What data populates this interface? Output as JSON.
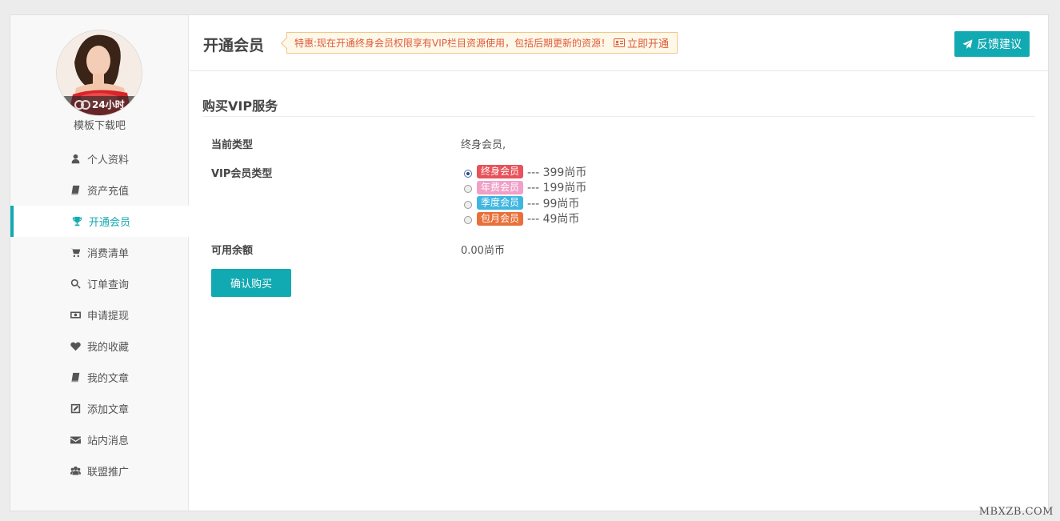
{
  "user": {
    "avatar_caption": "24小时",
    "username": "模板下载吧"
  },
  "sidebar": {
    "items": [
      {
        "label": "个人资料",
        "icon": "user-icon"
      },
      {
        "label": "资产充值",
        "icon": "book-icon"
      },
      {
        "label": "开通会员",
        "icon": "trophy-icon",
        "active": true
      },
      {
        "label": "消费清单",
        "icon": "cart-icon"
      },
      {
        "label": "订单查询",
        "icon": "search-icon"
      },
      {
        "label": "申请提现",
        "icon": "money-icon"
      },
      {
        "label": "我的收藏",
        "icon": "heart-icon"
      },
      {
        "label": "我的文章",
        "icon": "book-icon"
      },
      {
        "label": "添加文章",
        "icon": "edit-icon"
      },
      {
        "label": "站内消息",
        "icon": "envelope-icon"
      },
      {
        "label": "联盟推广",
        "icon": "users-icon"
      }
    ]
  },
  "header": {
    "title": "开通会员",
    "notice_text": "特惠:现在开通终身会员权限享有VIP栏目资源使用，包括后期更新的资源！",
    "notice_link": "立即开通",
    "feedback_label": "反馈建议"
  },
  "content": {
    "section_title": "购买VIP服务",
    "current_type_label": "当前类型",
    "current_type_value": "终身会员,",
    "vip_type_label": "VIP会员类型",
    "vip_options": [
      {
        "tag": "终身会员",
        "price": "--- 399尚币",
        "color": "#e8525a",
        "checked": true
      },
      {
        "tag": "年费会员",
        "price": "--- 199尚币",
        "color": "#f0a0c8",
        "checked": false
      },
      {
        "tag": "季度会员",
        "price": "--- 99尚币",
        "color": "#3fb6e0",
        "checked": false
      },
      {
        "tag": "包月会员",
        "price": "--- 49尚币",
        "color": "#e8703a",
        "checked": false
      }
    ],
    "balance_label": "可用余额",
    "balance_value": "0.00尚币",
    "buy_label": "确认购买"
  },
  "watermark": "MBXZB.COM",
  "colors": {
    "accent": "#12aab2"
  }
}
